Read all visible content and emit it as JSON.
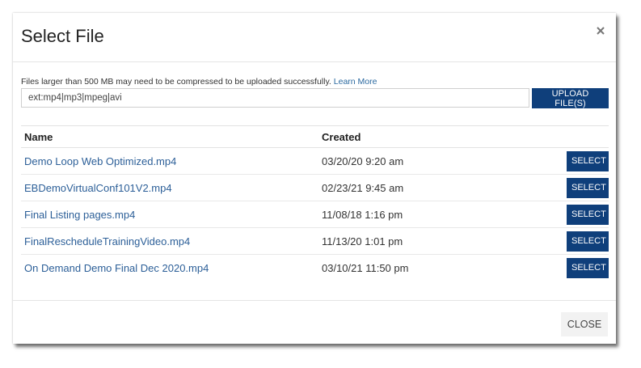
{
  "dialog": {
    "title": "Select File",
    "close_icon": "close-icon"
  },
  "upload": {
    "note": "Files larger than 500 MB may need to be compressed to be uploaded successfully.",
    "learn_more": "Learn More",
    "filter_value": "ext:mp4|mp3|mpeg|avi",
    "upload_label": "UPLOAD FILE(S)"
  },
  "table": {
    "columns": [
      "Name",
      "Created",
      ""
    ],
    "rows": [
      {
        "name": "Demo Loop Web Optimized.mp4",
        "created": "03/20/20 9:20 am",
        "action": "SELECT"
      },
      {
        "name": "EBDemoVirtualConf101V2.mp4",
        "created": "02/23/21 9:45 am",
        "action": "SELECT"
      },
      {
        "name": "Final Listing pages.mp4",
        "created": "11/08/18 1:16 pm",
        "action": "SELECT"
      },
      {
        "name": "FinalRescheduleTrainingVideo.mp4",
        "created": "11/13/20 1:01 pm",
        "action": "SELECT"
      },
      {
        "name": "On Demand Demo Final Dec 2020.mp4",
        "created": "03/10/21 11:50 pm",
        "action": "SELECT"
      }
    ]
  },
  "footer": {
    "close_label": "CLOSE"
  },
  "colors": {
    "primary_button": "#0f3f7b",
    "link": "#2c5f98"
  }
}
